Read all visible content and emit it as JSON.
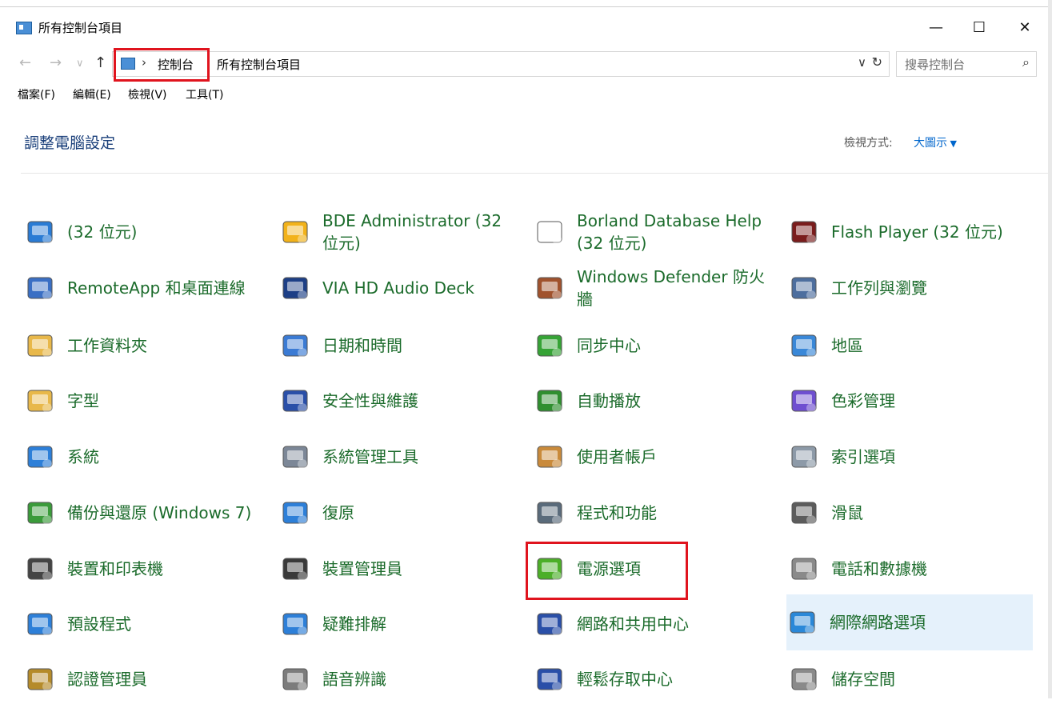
{
  "window": {
    "title": "所有控制台項目",
    "controls": {
      "minimize": "—",
      "maximize": "☐",
      "close": "✕"
    }
  },
  "address": {
    "breadcrumb": [
      "控制台",
      "所有控制台項目"
    ],
    "separator": "›",
    "dropdown": "∨",
    "refresh": "↻",
    "search_placeholder": "搜尋控制台",
    "search_icon": "⌕"
  },
  "menu": [
    "檔案(F)",
    "編輯(E)",
    "檢視(V)",
    "工具(T)"
  ],
  "panel": {
    "heading": "調整電腦設定",
    "view_by_label": "檢視方式:",
    "view_by_value": "大圖示"
  },
  "items": [
    {
      "label": "(32 位元)",
      "icon": "32bit-config-icon",
      "color": "#2a7bd4"
    },
    {
      "label": "BDE Administrator (32 位元)",
      "icon": "bde-gear-icon",
      "color": "#f2b21a"
    },
    {
      "label": "Borland Database Help (32 位元)",
      "icon": "document-icon",
      "color": "#ffffff"
    },
    {
      "label": "Flash Player (32 位元)",
      "icon": "flash-icon",
      "color": "#7a1c1c"
    },
    {
      "label": "RemoteApp 和桌面連線",
      "icon": "remoteapp-icon",
      "color": "#3a6fc4"
    },
    {
      "label": "VIA HD Audio Deck",
      "icon": "via-audio-icon",
      "color": "#1d3f86"
    },
    {
      "label": "Windows Defender 防火牆",
      "icon": "firewall-icon",
      "color": "#a0522d"
    },
    {
      "label": "工作列與瀏覽",
      "icon": "taskbar-icon",
      "color": "#4d6e9e"
    },
    {
      "label": "工作資料夾",
      "icon": "work-folder-icon",
      "color": "#e8b84a"
    },
    {
      "label": "日期和時間",
      "icon": "calendar-clock-icon",
      "color": "#3b7bd4"
    },
    {
      "label": "同步中心",
      "icon": "sync-icon",
      "color": "#36a336"
    },
    {
      "label": "地區",
      "icon": "globe-clock-icon",
      "color": "#3a88d8"
    },
    {
      "label": "字型",
      "icon": "font-folder-icon",
      "color": "#e8b84a"
    },
    {
      "label": "安全性與維護",
      "icon": "flag-icon",
      "color": "#2a4fa8"
    },
    {
      "label": "自動播放",
      "icon": "autoplay-icon",
      "color": "#2f8f2f"
    },
    {
      "label": "色彩管理",
      "icon": "color-management-icon",
      "color": "#6f4fd0"
    },
    {
      "label": "系統",
      "icon": "computer-icon",
      "color": "#2d7fd8"
    },
    {
      "label": "系統管理工具",
      "icon": "admin-tools-icon",
      "color": "#7c8797"
    },
    {
      "label": "使用者帳戶",
      "icon": "user-accounts-icon",
      "color": "#c98a3b"
    },
    {
      "label": "索引選項",
      "icon": "magnifier-icon",
      "color": "#8d9aa8"
    },
    {
      "label": "備份與還原 (Windows 7)",
      "icon": "backup-icon",
      "color": "#3a9b3a"
    },
    {
      "label": "復原",
      "icon": "recovery-icon",
      "color": "#2d7fd8"
    },
    {
      "label": "程式和功能",
      "icon": "programs-icon",
      "color": "#5a6b7b"
    },
    {
      "label": "滑鼠",
      "icon": "mouse-icon",
      "color": "#5c5c5c"
    },
    {
      "label": "裝置和印表機",
      "icon": "printer-icon",
      "color": "#444444"
    },
    {
      "label": "裝置管理員",
      "icon": "device-manager-icon",
      "color": "#3a3a3a"
    },
    {
      "label": "電源選項",
      "icon": "battery-plug-icon",
      "color": "#4caf28"
    },
    {
      "label": "電話和數據機",
      "icon": "fax-icon",
      "color": "#8a8a8a"
    },
    {
      "label": "預設程式",
      "icon": "default-programs-icon",
      "color": "#2d7fd8"
    },
    {
      "label": "疑難排解",
      "icon": "troubleshoot-icon",
      "color": "#2d7fd8"
    },
    {
      "label": "網路和共用中心",
      "icon": "network-icon",
      "color": "#2a4fa8"
    },
    {
      "label": "網際網路選項",
      "icon": "internet-options-icon",
      "color": "#2a88d8"
    },
    {
      "label": "認證管理員",
      "icon": "credential-icon",
      "color": "#b58b2a"
    },
    {
      "label": "語音辨識",
      "icon": "microphone-icon",
      "color": "#7c7c7c"
    },
    {
      "label": "輕鬆存取中心",
      "icon": "ease-of-access-icon",
      "color": "#2a4fa8"
    },
    {
      "label": "儲存空間",
      "icon": "storage-icon",
      "color": "#8a8a8a"
    }
  ],
  "colors": {
    "link_green": "#1b6b2b",
    "highlight_red": "#e0141e",
    "selection_blue": "#e5f1fb"
  }
}
